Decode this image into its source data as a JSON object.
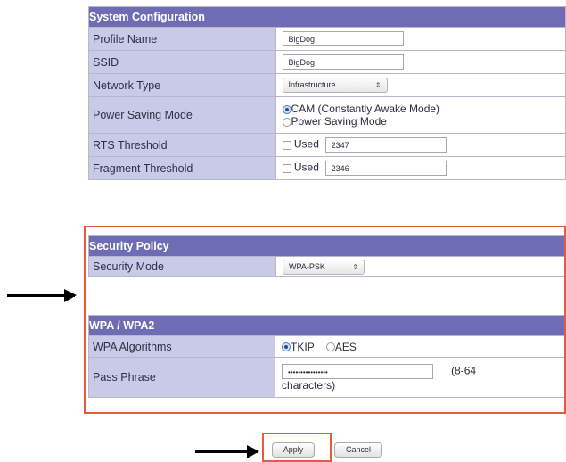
{
  "system_configuration": {
    "header": "System Configuration",
    "profile_name": {
      "label": "Profile Name",
      "value": "BigDog"
    },
    "ssid": {
      "label": "SSID",
      "value": "BigDog"
    },
    "network_type": {
      "label": "Network Type",
      "value": "Infrastructure"
    },
    "power_saving_mode": {
      "label": "Power Saving Mode",
      "options": [
        "CAM (Constantly Awake Mode)",
        "Power Saving Mode"
      ],
      "selected": "CAM (Constantly Awake Mode)"
    },
    "rts_threshold": {
      "label": "RTS Threshold",
      "used_label": "Used",
      "used_checked": false,
      "value": "2347"
    },
    "fragment_threshold": {
      "label": "Fragment Threshold",
      "used_label": "Used",
      "used_checked": false,
      "value": "2346"
    }
  },
  "security_policy": {
    "header": "Security Policy",
    "security_mode": {
      "label": "Security Mode",
      "value": "WPA-PSK"
    }
  },
  "wpa": {
    "header": "WPA / WPA2",
    "algorithms": {
      "label": "WPA Algorithms",
      "options": [
        "TKIP",
        "AES"
      ],
      "selected": "TKIP"
    },
    "pass_phrase": {
      "label": "Pass Phrase",
      "value": "••••••••••••••••",
      "hint_1": "(8-64",
      "hint_2": "characters)"
    }
  },
  "buttons": {
    "apply": "Apply",
    "cancel": "Cancel"
  },
  "colors": {
    "header_bg": "#6e6cb3",
    "label_bg": "#c9c9e8",
    "highlight": "#e85a3c"
  }
}
